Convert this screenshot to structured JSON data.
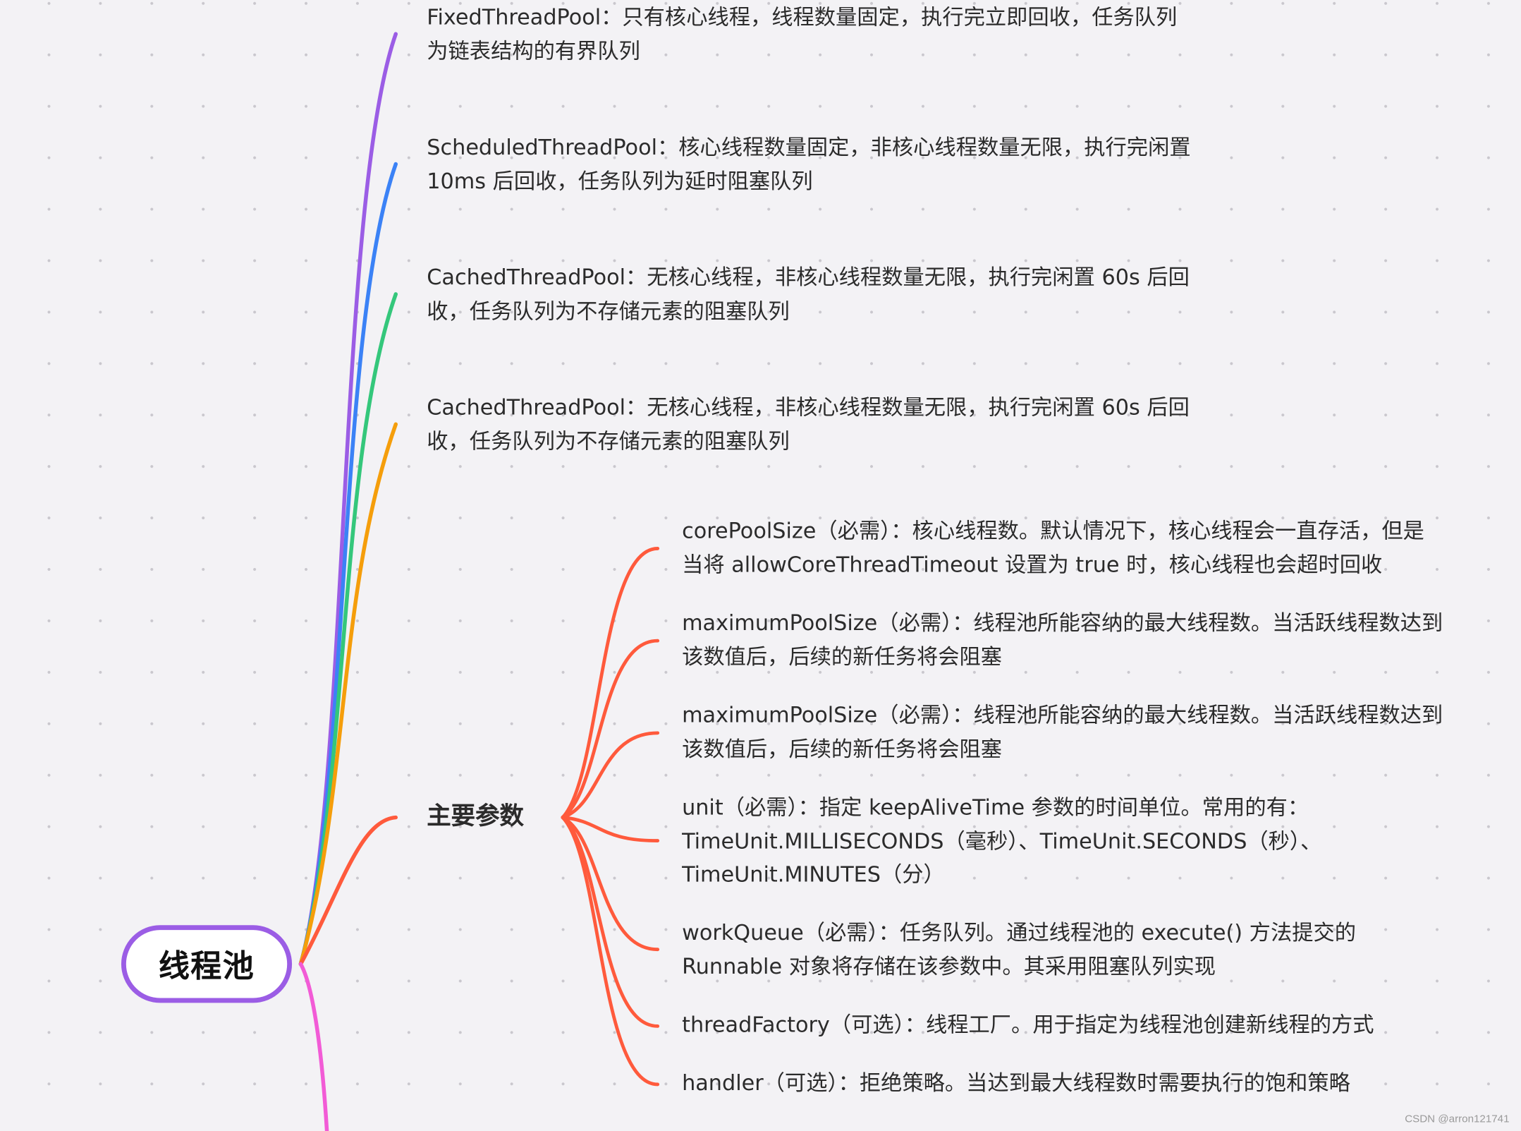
{
  "root": {
    "label": "线程池"
  },
  "pool_types": [
    {
      "lines": [
        "FixedThreadPool：只有核心线程，线程数量固定，执行完立即回收，任务队列",
        "为链表结构的有界队列"
      ],
      "color": "#9b5de5"
    },
    {
      "lines": [
        "ScheduledThreadPool：核心线程数量固定，非核心线程数量无限，执行完闲置",
        "10ms 后回收，任务队列为延时阻塞队列"
      ],
      "color": "#3b82f6"
    },
    {
      "lines": [
        "CachedThreadPool：无核心线程，非核心线程数量无限，执行完闲置 60s 后回",
        "收，任务队列为不存储元素的阻塞队列"
      ],
      "color": "#34c77b"
    },
    {
      "lines": [
        "CachedThreadPool：无核心线程，非核心线程数量无限，执行完闲置 60s 后回",
        "收，任务队列为不存储元素的阻塞队列"
      ],
      "color": "#f59e0b"
    }
  ],
  "params": {
    "label": "主要参数",
    "color": "#ff5a3c",
    "items": [
      {
        "lines": [
          "corePoolSize（必需）：核心线程数。默认情况下，核心线程会一直存活，但是",
          "当将 allowCoreThreadTimeout 设置为 true 时，核心线程也会超时回收"
        ]
      },
      {
        "lines": [
          "maximumPoolSize（必需）：线程池所能容纳的最大线程数。当活跃线程数达到",
          "该数值后，后续的新任务将会阻塞"
        ]
      },
      {
        "lines": [
          "maximumPoolSize（必需）：线程池所能容纳的最大线程数。当活跃线程数达到",
          "该数值后，后续的新任务将会阻塞"
        ]
      },
      {
        "lines": [
          "unit（必需）：指定 keepAliveTime 参数的时间单位。常用的有：",
          "TimeUnit.MILLISECONDS（毫秒）、TimeUnit.SECONDS（秒）、",
          "TimeUnit.MINUTES（分）"
        ]
      },
      {
        "lines": [
          "workQueue（必需）：任务队列。通过线程池的 execute() 方法提交的",
          "Runnable 对象将存储在该参数中。其采用阻塞队列实现"
        ]
      },
      {
        "lines": [
          "threadFactory（可选）：线程工厂。用于指定为线程池创建新线程的方式"
        ]
      },
      {
        "lines": [
          "handler（可选）：拒绝策略。当达到最大线程数时需要执行的饱和策略"
        ]
      }
    ]
  },
  "extra_branch_color": "#f25bd6",
  "watermark": "CSDN @arron121741"
}
